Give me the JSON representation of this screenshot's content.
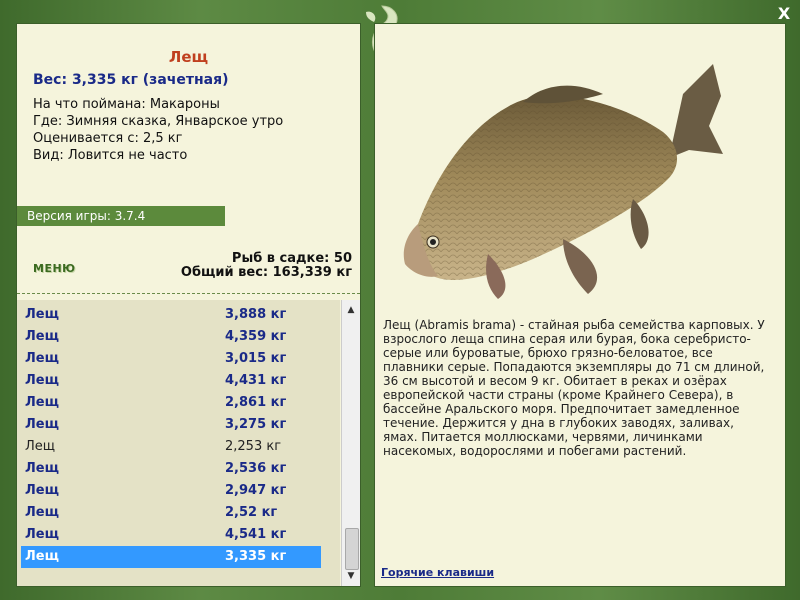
{
  "window": {
    "close_label": "X"
  },
  "catch": {
    "name": "Лещ",
    "weight_line": "Вес: 3,335 кг (зачетная)",
    "bait": "На что поймана: Макароны",
    "location": "Где: Зимняя сказка, Январское утро",
    "rated_from": "Оценивается с: 2,5 кг",
    "rarity": "Вид: Ловится не часто"
  },
  "version": "Версия игры: 3.7.4",
  "menu_label": "МЕНЮ",
  "keepnet": {
    "count_line": "Рыб в садке: 50",
    "total_line": "Общий вес: 163,339 кг"
  },
  "list": [
    {
      "name": "Лещ",
      "weight": "3,888 кг",
      "style": "bold"
    },
    {
      "name": "Лещ",
      "weight": "4,359 кг",
      "style": "bold"
    },
    {
      "name": "Лещ",
      "weight": "3,015 кг",
      "style": "bold"
    },
    {
      "name": "Лещ",
      "weight": "4,431 кг",
      "style": "bold"
    },
    {
      "name": "Лещ",
      "weight": "2,861 кг",
      "style": "bold"
    },
    {
      "name": "Лещ",
      "weight": "3,275 кг",
      "style": "bold"
    },
    {
      "name": "Лещ",
      "weight": "2,253 кг",
      "style": "plain"
    },
    {
      "name": "Лещ",
      "weight": "2,536 кг",
      "style": "bold"
    },
    {
      "name": "Лещ",
      "weight": "2,947 кг",
      "style": "bold"
    },
    {
      "name": "Лещ",
      "weight": "2,52 кг",
      "style": "bold"
    },
    {
      "name": "Лещ",
      "weight": "4,541 кг",
      "style": "bold"
    },
    {
      "name": "Лещ",
      "weight": "3,335 кг",
      "style": "sel"
    }
  ],
  "description": "Лещ (Abramis brama) - стайная рыба семейства карповых. У взрослого леща спина серая или бурая, бока серебристо-серые или буроватые, брюхо грязно-беловатое, все плавники серые. Попадаются экземпляры до 71 см длиной, 36 см высотой и весом 9 кг. Обитает в реках и озёрах европейской части страны (кроме Крайнего Севера), в бассейне Аральского моря. Предпочитает замедленное течение. Держится у дна в глубоких заводях, заливах, ямах. Питается моллюсками, червями, личинками насекомых, водорослями и побегами растений.",
  "hotkeys_label": "Горячие клавиши",
  "colors": {
    "frame": "#4f7a3a",
    "panel": "#f5f4dc",
    "name_red": "#c0401f",
    "weight_blue": "#1a2a88",
    "selection": "#3399ff"
  },
  "icons": {
    "close": "close-icon",
    "logo": "leaf-logo-icon",
    "scroll_up": "chevron-up-icon",
    "scroll_down": "chevron-down-icon"
  }
}
